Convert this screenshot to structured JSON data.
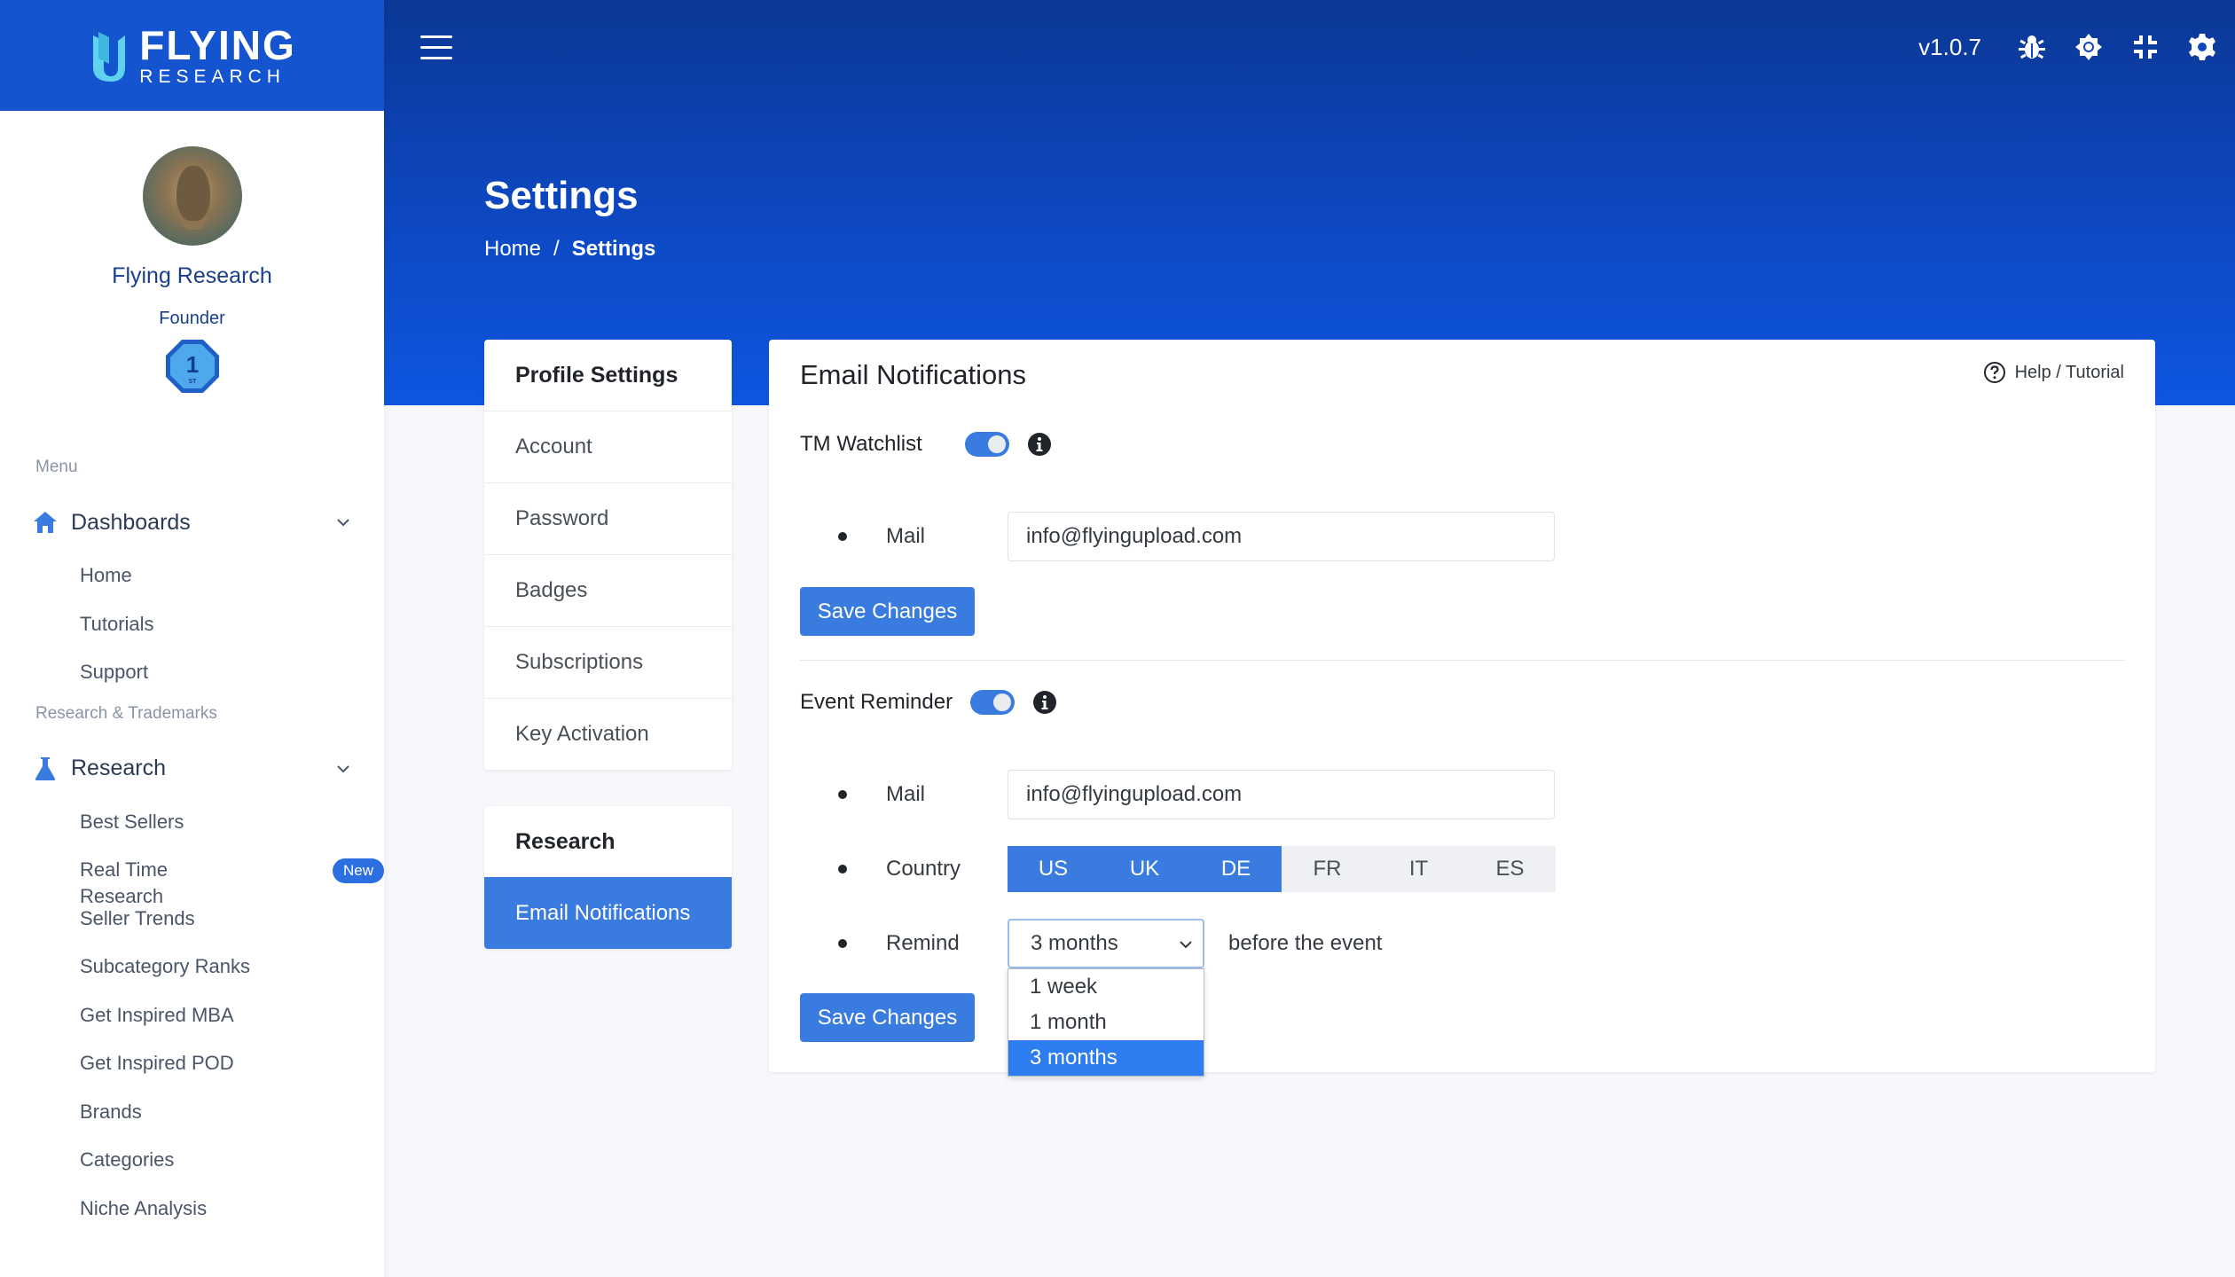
{
  "brand": {
    "line1": "FLYING",
    "line2": "RESEARCH"
  },
  "profile": {
    "name": "Flying Research",
    "role": "Founder",
    "badge_number": "1",
    "badge_suffix": "ST"
  },
  "sidebar": {
    "section1": "Menu",
    "group1": {
      "label": "Dashboards",
      "items": [
        "Home",
        "Tutorials",
        "Support"
      ]
    },
    "section2": "Research & Trademarks",
    "group2": {
      "label": "Research",
      "items": [
        "Best Sellers",
        "Real Time Research",
        "Seller Trends",
        "Subcategory Ranks",
        "Get Inspired MBA",
        "Get Inspired POD",
        "Brands",
        "Categories",
        "Niche Analysis"
      ],
      "new_badge": "New"
    }
  },
  "topbar": {
    "version": "v1.0.7"
  },
  "page": {
    "title": "Settings",
    "breadcrumb_home": "Home",
    "breadcrumb_sep": "/",
    "breadcrumb_current": "Settings"
  },
  "settings_nav": {
    "profile_heading": "Profile Settings",
    "profile_items": [
      "Account",
      "Password",
      "Badges",
      "Subscriptions",
      "Key Activation"
    ],
    "research_heading": "Research",
    "research_items": [
      "Email Notifications"
    ]
  },
  "card": {
    "title": "Email Notifications",
    "help_label": "Help / Tutorial",
    "tm_watchlist": {
      "label": "TM Watchlist",
      "enabled": true,
      "mail_label": "Mail",
      "mail_value": "info@flyingupload.com",
      "save_label": "Save Changes"
    },
    "event_reminder": {
      "label": "Event Reminder",
      "enabled": true,
      "mail_label": "Mail",
      "mail_value": "info@flyingupload.com",
      "country_label": "Country",
      "countries": [
        "US",
        "UK",
        "DE",
        "FR",
        "IT",
        "ES"
      ],
      "countries_selected": [
        "US",
        "UK",
        "DE"
      ],
      "remind_label": "Remind",
      "remind_value": "3 months",
      "remind_options": [
        "1 week",
        "1 month",
        "3 months"
      ],
      "after_text": "before the event",
      "save_label": "Save Changes"
    }
  },
  "colors": {
    "brand_blue": "#1554cf",
    "accent": "#3a7be0",
    "header_top": "#0c3896",
    "header_bottom": "#0e56e0"
  }
}
